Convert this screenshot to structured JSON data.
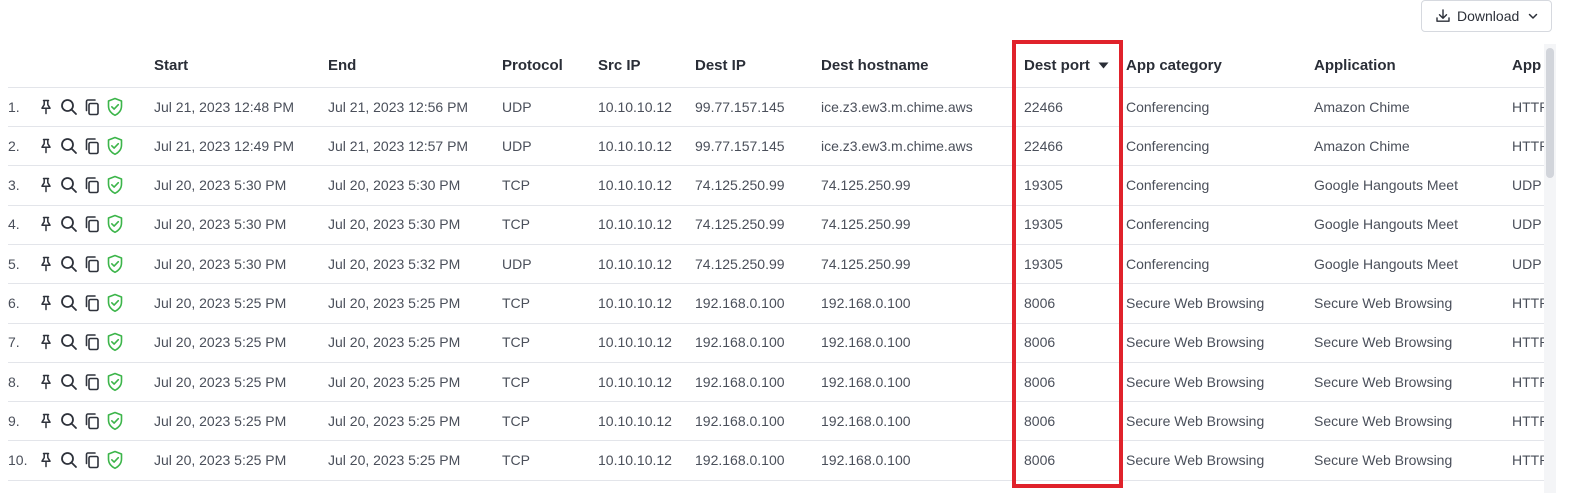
{
  "toolbar": {
    "download_label": "Download",
    "download_icon": "download-icon",
    "dropdown_icon": "chevron-down-icon"
  },
  "table": {
    "columns": {
      "start": "Start",
      "end": "End",
      "protocol": "Protocol",
      "src_ip": "Src IP",
      "dest_ip": "Dest IP",
      "dest_hostname": "Dest hostname",
      "dest_port": "Dest port",
      "app_category": "App category",
      "application": "Application",
      "app_protocol": "App"
    },
    "sorted_column": "dest_port",
    "sort_direction": "descending",
    "row_action_icons": [
      "pin-icon",
      "search-icon",
      "copy-icon",
      "shield-check-icon"
    ],
    "rows": [
      {
        "index": "1.",
        "start": "Jul 21, 2023 12:48 PM",
        "end": "Jul 21, 2023 12:56 PM",
        "protocol": "UDP",
        "src_ip": "10.10.10.12",
        "dest_ip": "99.77.157.145",
        "dest_hostname": "ice.z3.ew3.m.chime.aws",
        "dest_port": "22466",
        "app_category": "Conferencing",
        "application": "Amazon Chime",
        "app_protocol": "HTTP"
      },
      {
        "index": "2.",
        "start": "Jul 21, 2023 12:49 PM",
        "end": "Jul 21, 2023 12:57 PM",
        "protocol": "UDP",
        "src_ip": "10.10.10.12",
        "dest_ip": "99.77.157.145",
        "dest_hostname": "ice.z3.ew3.m.chime.aws",
        "dest_port": "22466",
        "app_category": "Conferencing",
        "application": "Amazon Chime",
        "app_protocol": "HTTP"
      },
      {
        "index": "3.",
        "start": "Jul 20, 2023 5:30 PM",
        "end": "Jul 20, 2023 5:30 PM",
        "protocol": "TCP",
        "src_ip": "10.10.10.12",
        "dest_ip": "74.125.250.99",
        "dest_hostname": "74.125.250.99",
        "dest_port": "19305",
        "app_category": "Conferencing",
        "application": "Google Hangouts Meet",
        "app_protocol": "UDP"
      },
      {
        "index": "4.",
        "start": "Jul 20, 2023 5:30 PM",
        "end": "Jul 20, 2023 5:30 PM",
        "protocol": "TCP",
        "src_ip": "10.10.10.12",
        "dest_ip": "74.125.250.99",
        "dest_hostname": "74.125.250.99",
        "dest_port": "19305",
        "app_category": "Conferencing",
        "application": "Google Hangouts Meet",
        "app_protocol": "UDP"
      },
      {
        "index": "5.",
        "start": "Jul 20, 2023 5:30 PM",
        "end": "Jul 20, 2023 5:32 PM",
        "protocol": "UDP",
        "src_ip": "10.10.10.12",
        "dest_ip": "74.125.250.99",
        "dest_hostname": "74.125.250.99",
        "dest_port": "19305",
        "app_category": "Conferencing",
        "application": "Google Hangouts Meet",
        "app_protocol": "UDP"
      },
      {
        "index": "6.",
        "start": "Jul 20, 2023 5:25 PM",
        "end": "Jul 20, 2023 5:25 PM",
        "protocol": "TCP",
        "src_ip": "10.10.10.12",
        "dest_ip": "192.168.0.100",
        "dest_hostname": "192.168.0.100",
        "dest_port": "8006",
        "app_category": "Secure Web Browsing",
        "application": "Secure Web Browsing",
        "app_protocol": "HTTP"
      },
      {
        "index": "7.",
        "start": "Jul 20, 2023 5:25 PM",
        "end": "Jul 20, 2023 5:25 PM",
        "protocol": "TCP",
        "src_ip": "10.10.10.12",
        "dest_ip": "192.168.0.100",
        "dest_hostname": "192.168.0.100",
        "dest_port": "8006",
        "app_category": "Secure Web Browsing",
        "application": "Secure Web Browsing",
        "app_protocol": "HTTP"
      },
      {
        "index": "8.",
        "start": "Jul 20, 2023 5:25 PM",
        "end": "Jul 20, 2023 5:25 PM",
        "protocol": "TCP",
        "src_ip": "10.10.10.12",
        "dest_ip": "192.168.0.100",
        "dest_hostname": "192.168.0.100",
        "dest_port": "8006",
        "app_category": "Secure Web Browsing",
        "application": "Secure Web Browsing",
        "app_protocol": "HTTP"
      },
      {
        "index": "9.",
        "start": "Jul 20, 2023 5:25 PM",
        "end": "Jul 20, 2023 5:25 PM",
        "protocol": "TCP",
        "src_ip": "10.10.10.12",
        "dest_ip": "192.168.0.100",
        "dest_hostname": "192.168.0.100",
        "dest_port": "8006",
        "app_category": "Secure Web Browsing",
        "application": "Secure Web Browsing",
        "app_protocol": "HTTP"
      },
      {
        "index": "10.",
        "start": "Jul 20, 2023 5:25 PM",
        "end": "Jul 20, 2023 5:25 PM",
        "protocol": "TCP",
        "src_ip": "10.10.10.12",
        "dest_ip": "192.168.0.100",
        "dest_hostname": "192.168.0.100",
        "dest_port": "8006",
        "app_category": "Secure Web Browsing",
        "application": "Secure Web Browsing",
        "app_protocol": "HTTP"
      }
    ]
  },
  "colors": {
    "highlight": "#e0222b",
    "shield_green": "#3cb54a",
    "row_divider": "#e3e5ea"
  }
}
